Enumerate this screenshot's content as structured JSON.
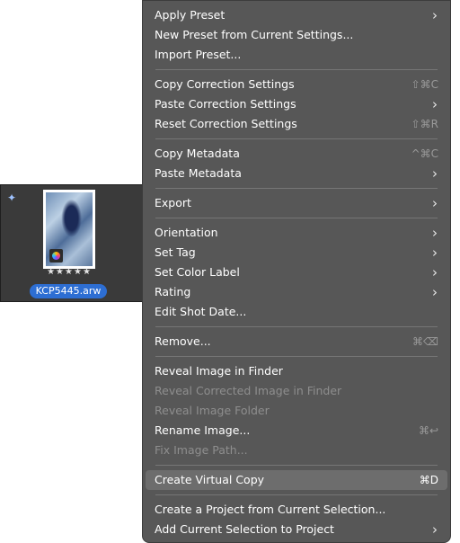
{
  "thumbnail": {
    "wand_icon": "magic-wand-icon",
    "badge_icon": "color-wheel-icon",
    "rating": "★★★★★",
    "filename": "KCP5445.arw"
  },
  "menu": {
    "items": [
      {
        "label": "Apply Preset",
        "submenu": true
      },
      {
        "label": "New Preset from Current Settings..."
      },
      {
        "label": "Import Preset..."
      },
      {
        "label": "Copy Correction Settings",
        "shortcut": "⇧⌘C"
      },
      {
        "label": "Paste Correction Settings",
        "submenu": true
      },
      {
        "label": "Reset Correction Settings",
        "shortcut": "⇧⌘R"
      },
      {
        "label": "Copy Metadata",
        "shortcut": "^⌘C"
      },
      {
        "label": "Paste Metadata",
        "submenu": true
      },
      {
        "label": "Export",
        "submenu": true
      },
      {
        "label": "Orientation",
        "submenu": true
      },
      {
        "label": "Set Tag",
        "submenu": true
      },
      {
        "label": "Set Color Label",
        "submenu": true
      },
      {
        "label": "Rating",
        "submenu": true
      },
      {
        "label": "Edit Shot Date..."
      },
      {
        "label": "Remove...",
        "shortcut": "⌘⌫"
      },
      {
        "label": "Reveal Image in Finder"
      },
      {
        "label": "Reveal Corrected Image in Finder",
        "disabled": true
      },
      {
        "label": "Reveal Image Folder",
        "disabled": true
      },
      {
        "label": "Rename Image...",
        "shortcut": "⌘↩"
      },
      {
        "label": "Fix Image Path...",
        "disabled": true
      },
      {
        "label": "Create Virtual Copy",
        "shortcut": "⌘D",
        "highlighted": true
      },
      {
        "label": "Create a Project from Current Selection..."
      },
      {
        "label": "Add Current Selection to Project",
        "submenu": true
      }
    ],
    "submenu_glyph": "›"
  }
}
